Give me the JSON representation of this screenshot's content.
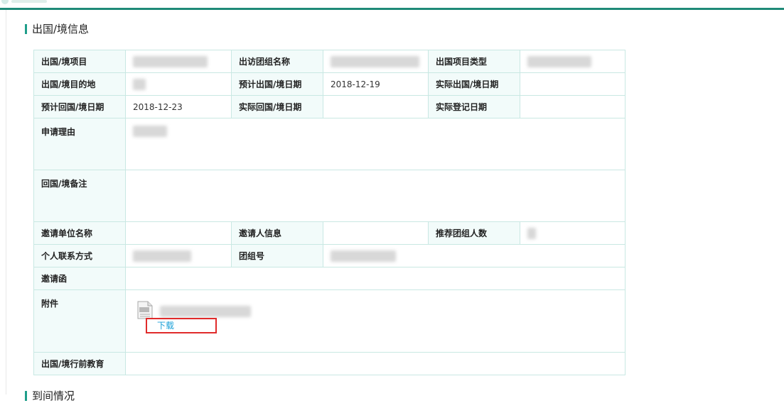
{
  "sections": {
    "info_title": "出国/境信息",
    "progress_title": "到间情况"
  },
  "labels": {
    "project": "出国/境项目",
    "group_name": "出访团组名称",
    "project_type": "出国项目类型",
    "destination": "出国/境目的地",
    "planned_departure": "预计出国/境日期",
    "actual_departure": "实际出国/境日期",
    "planned_return": "预计回国/境日期",
    "actual_return": "实际回国/境日期",
    "actual_register": "实际登记日期",
    "reason": "申请理由",
    "return_remark": "回国/境备注",
    "inviter_org": "邀请单位名称",
    "inviter_info": "邀请人信息",
    "recommended_group_size": "推荐团组人数",
    "personal_contact": "个人联系方式",
    "group_no": "团组号",
    "invitation": "邀请函",
    "attachment": "附件",
    "pre_departure_education": "出国/境行前教育"
  },
  "values": {
    "planned_departure": "2018-12-19",
    "planned_return": "2018-12-23"
  },
  "attachment": {
    "download_label": "下载",
    "icon": "document-icon"
  },
  "colors": {
    "accent": "#1f9e8a",
    "label_bg": "#f2fbfa",
    "border": "#c9e8e3",
    "link": "#1aa0d8",
    "highlight": "#e02b2b"
  }
}
